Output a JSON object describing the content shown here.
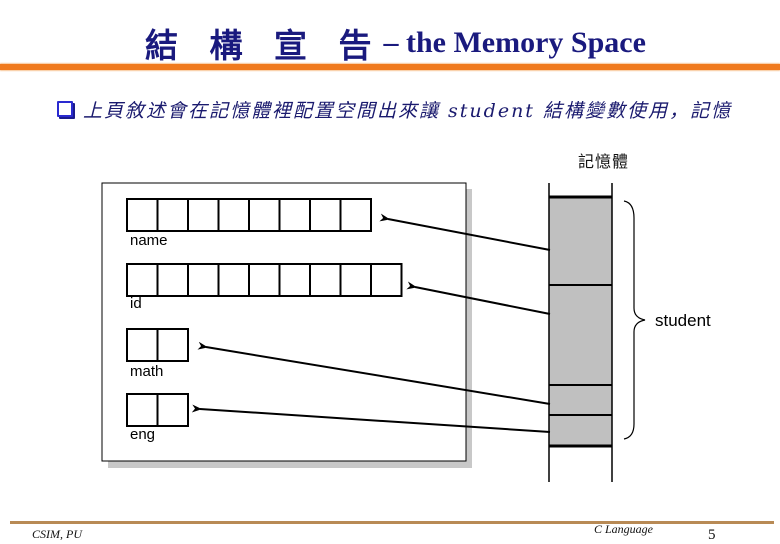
{
  "slide": {
    "title_zh": "結 構 宣 告",
    "title_en": "– the Memory Space",
    "bullet_text": "上頁敘述會在記憶體裡配置空間出來讓 student 結構變數使用，記憶",
    "memory_label": "記憶體",
    "struct_label": "student",
    "accent_color": "#f07a1e",
    "title_color": "#1a1a7e"
  },
  "fields": [
    {
      "name": "name",
      "cells": 8
    },
    {
      "name": "id",
      "cells": 9
    },
    {
      "name": "math",
      "cells": 2
    },
    {
      "name": "eng",
      "cells": 2
    }
  ],
  "footer": {
    "left": "CSIM, PU",
    "right": "C Language",
    "page": "5"
  }
}
